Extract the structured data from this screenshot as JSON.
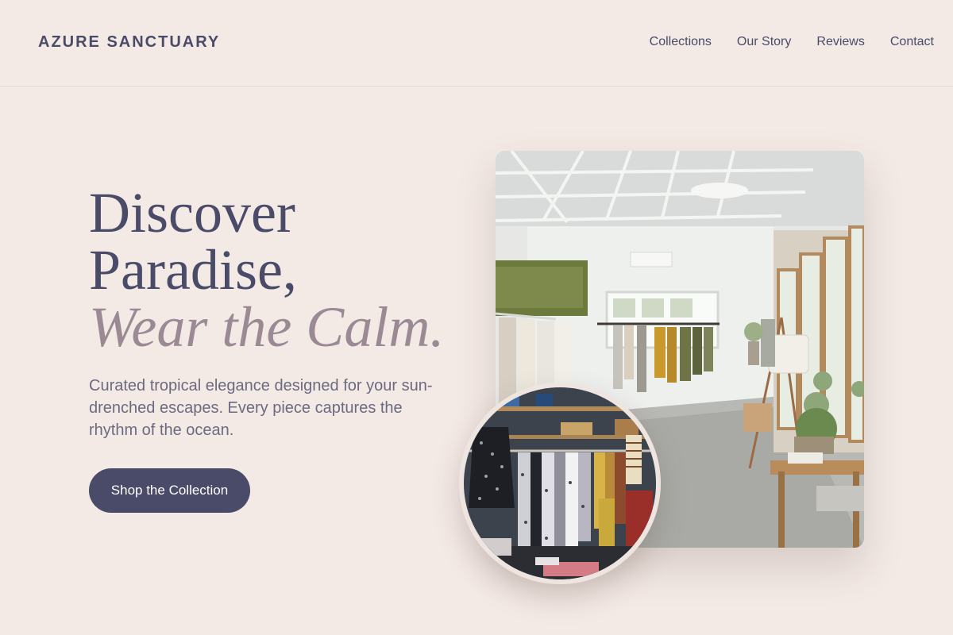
{
  "header": {
    "brand": "AZURE SANCTUARY",
    "nav": [
      "Collections",
      "Our Story",
      "Reviews",
      "Contact"
    ]
  },
  "hero": {
    "headline_line1": "Discover",
    "headline_line2": "Paradise,",
    "headline_accent": "Wear the Calm.",
    "tagline": "Curated tropical elegance designed for your sun-drenched escapes. Every piece captures the rhythm of the ocean.",
    "cta_label": "Shop the Collection"
  },
  "colors": {
    "background": "#f3e9e5",
    "primary": "#4a4b68",
    "accent": "#9b8a93"
  }
}
